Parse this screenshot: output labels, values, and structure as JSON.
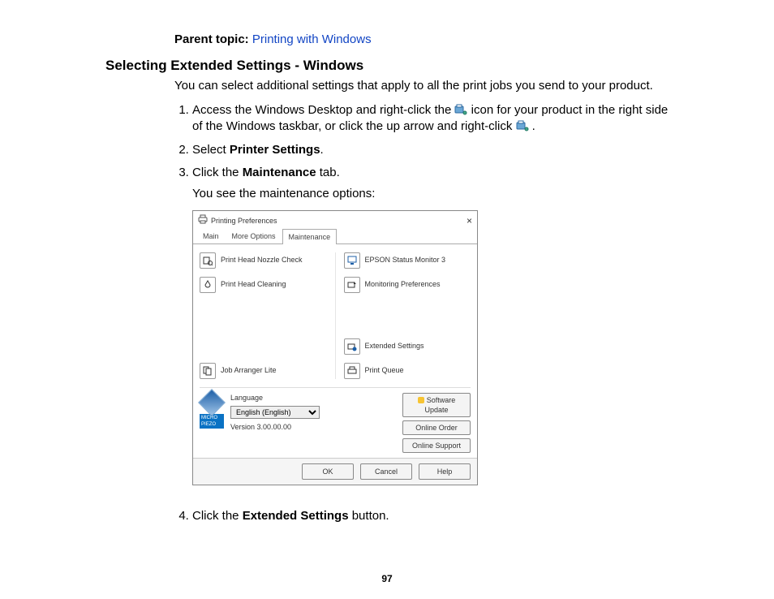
{
  "parent_topic": {
    "label": "Parent topic:",
    "link": "Printing with Windows"
  },
  "heading": "Selecting Extended Settings - Windows",
  "intro": "You can select additional settings that apply to all the print jobs you send to your product.",
  "steps": {
    "s1a": "Access the Windows Desktop and right-click the ",
    "s1b": " icon for your product in the right side of the Windows taskbar, or click the up arrow and right-click ",
    "s1c": ".",
    "s2a": "Select ",
    "s2b": "Printer Settings",
    "s2c": ".",
    "s3a": "Click the ",
    "s3b": "Maintenance",
    "s3c": " tab.",
    "s3note": "You see the maintenance options:",
    "s4a": "Click the ",
    "s4b": "Extended Settings",
    "s4c": " button."
  },
  "dialog": {
    "title": "Printing Preferences",
    "tabs": {
      "main": "Main",
      "more": "More Options",
      "maint": "Maintenance"
    },
    "left": {
      "nozzle": "Print Head Nozzle Check",
      "cleaning": "Print Head Cleaning",
      "job": "Job Arranger Lite"
    },
    "right": {
      "status": "EPSON Status Monitor 3",
      "monpref": "Monitoring Preferences",
      "ext": "Extended Settings",
      "queue": "Print Queue"
    },
    "info": {
      "lang_label": "Language",
      "lang_value": "English (English)",
      "version": "Version 3.00.00.00",
      "logo_tag": "MICRO PIEZO"
    },
    "side": {
      "update": "Software Update",
      "order": "Online Order",
      "support": "Online Support"
    },
    "footer": {
      "ok": "OK",
      "cancel": "Cancel",
      "help": "Help"
    }
  },
  "page_number": "97"
}
